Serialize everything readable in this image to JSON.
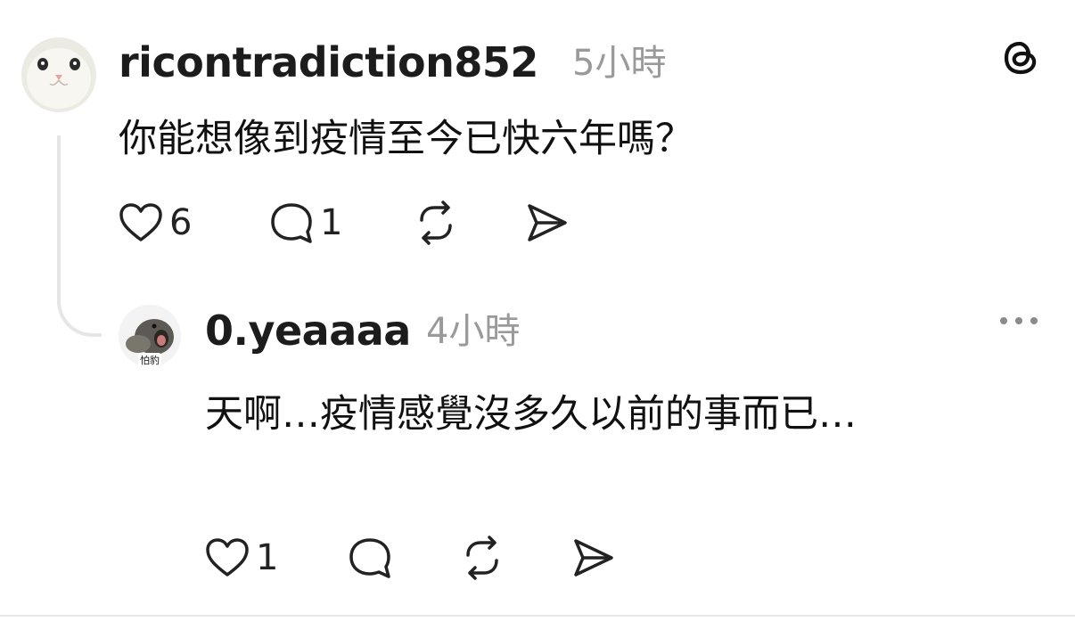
{
  "app": {
    "logo_icon": "threads-logo-icon"
  },
  "post": {
    "username": "ricontradiction852",
    "time": "5小時",
    "text": "你能想像到疫情至今已快六年嗎？",
    "actions": {
      "likes": "6",
      "replies": "1"
    }
  },
  "reply": {
    "username": "0.yeaaaa",
    "time": "4小時",
    "avatar_label": "怕豹",
    "text": "天啊…疫情感覺沒多久以前的事而已…",
    "actions": {
      "likes": "1"
    }
  }
}
